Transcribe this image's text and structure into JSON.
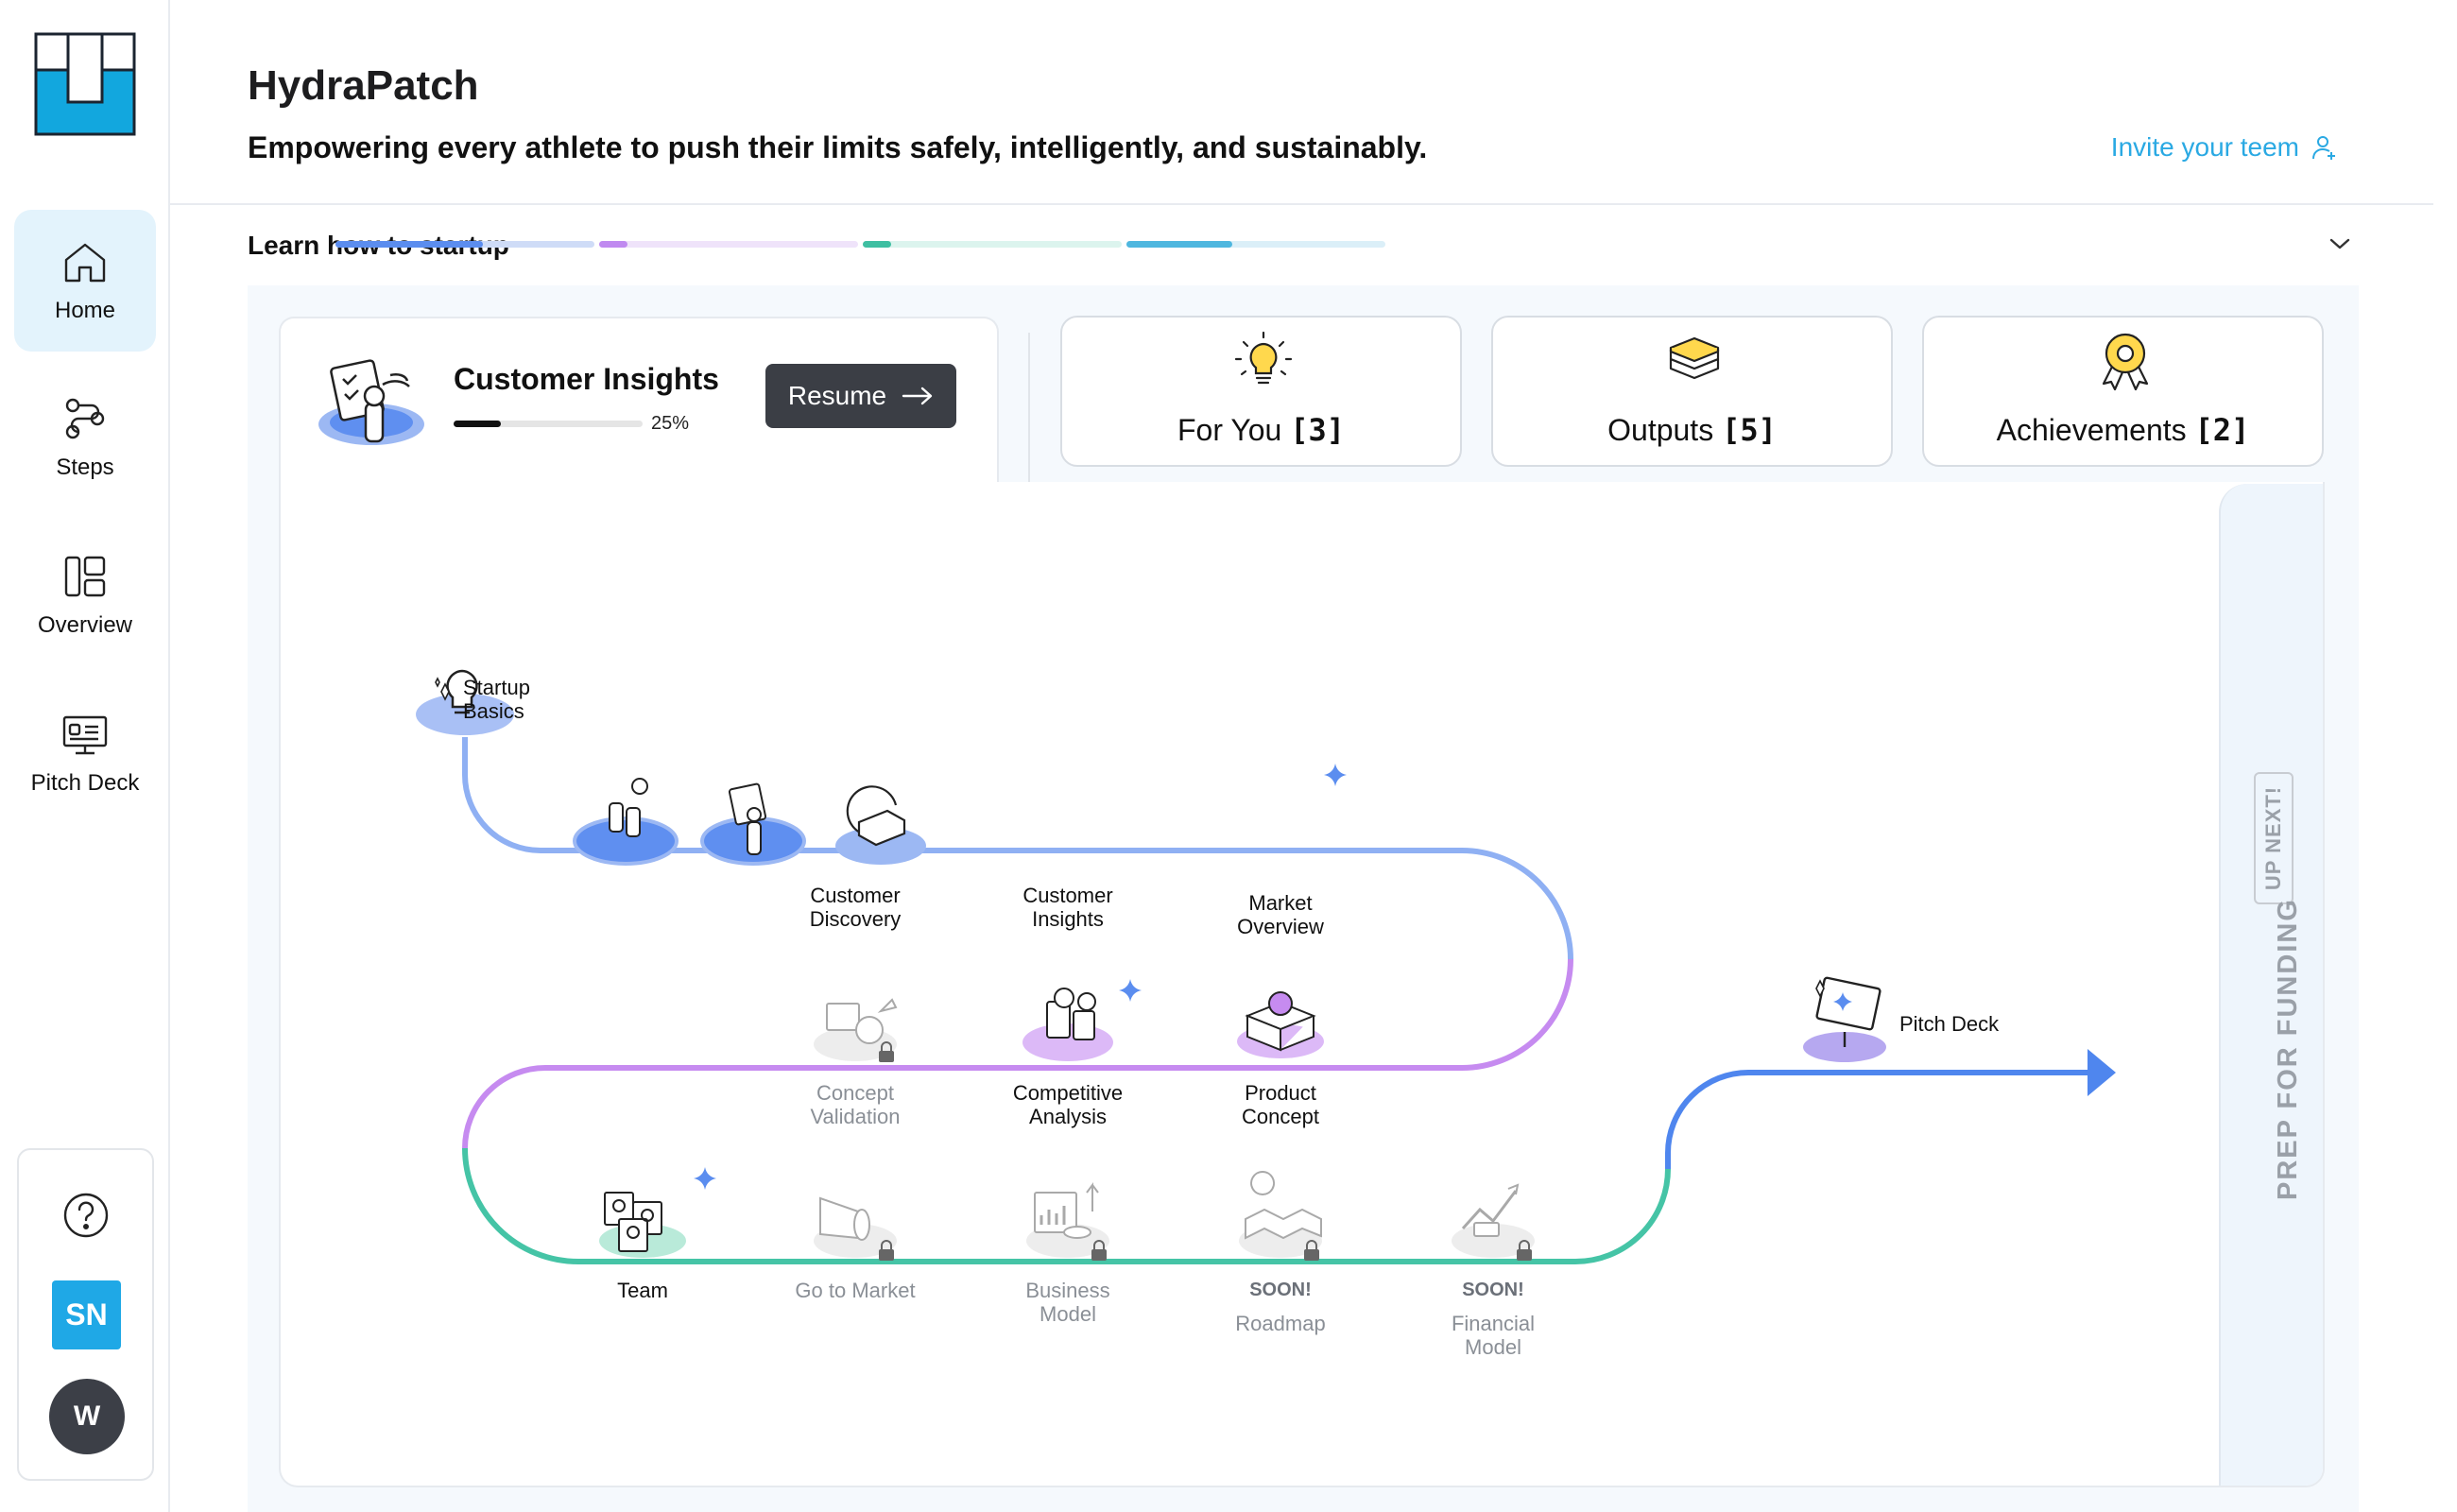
{
  "nav": {
    "items": [
      {
        "id": "home",
        "label": "Home",
        "active": true
      },
      {
        "id": "steps",
        "label": "Steps",
        "active": false
      },
      {
        "id": "overview",
        "label": "Overview",
        "active": false
      },
      {
        "id": "pitch",
        "label": "Pitch Deck",
        "active": false
      }
    ],
    "user_initials": "SN",
    "workspace_initial": "W"
  },
  "header": {
    "title": "HydraPatch",
    "subtitle": "Empowering every athlete to push their limits safely, intelligently, and sustainably.",
    "invite_label": "Invite your teem"
  },
  "progress": {
    "title": "Learn how to startup",
    "segments": [
      {
        "color": "#5b8def",
        "track": "#cfdcf7",
        "fraction": 0.57
      },
      {
        "color": "#c08af0",
        "track": "#efe3fa",
        "fraction": 0.11
      },
      {
        "color": "#3fbfa2",
        "track": "#dcf4ee",
        "fraction": 0.11
      },
      {
        "color": "#4fb7df",
        "track": "#dbeff8",
        "fraction": 0.41
      }
    ]
  },
  "resume": {
    "title": "Customer Insights",
    "percent_label": "25%",
    "percent": 25,
    "button_label": "Resume"
  },
  "tiles": [
    {
      "label": "For You",
      "count": "[3]",
      "icon": "lightbulb-icon"
    },
    {
      "label": "Outputs",
      "count": "[5]",
      "icon": "layers-icon"
    },
    {
      "label": "Achievements",
      "count": "[2]",
      "icon": "award-icon"
    }
  ],
  "journey": {
    "nodes": {
      "startup_basics": "Startup\nBasics",
      "customer_discovery": "Customer\nDiscovery",
      "customer_insights": "Customer\nInsights",
      "market_overview": "Market\nOverview",
      "concept_validation": "Concept\nValidation",
      "competitive_analysis": "Competitive\nAnalysis",
      "product_concept": "Product\nConcept",
      "team": "Team",
      "go_to_market": "Go to Market",
      "business_model": "Business\nModel",
      "roadmap": "Roadmap",
      "financial_model": "Financial\nModel",
      "pitch_deck": "Pitch Deck"
    },
    "soon_label": "SOON!",
    "up_next_label": "UP NEXT!",
    "prep_label": "PREP FOR FUNDING",
    "colors": {
      "blue": "#8fb0f3",
      "purple": "#c68bf0",
      "green": "#45c4a6",
      "finale": "#4f86ee"
    }
  }
}
